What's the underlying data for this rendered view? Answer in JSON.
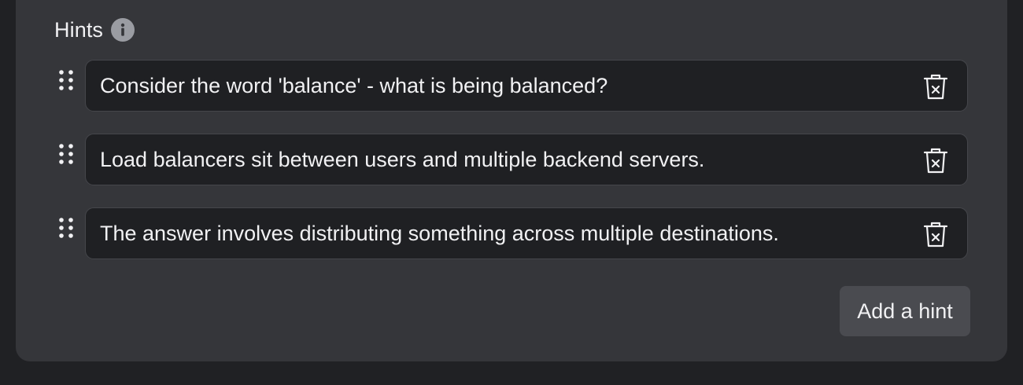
{
  "section": {
    "title": "Hints",
    "info_icon": "info-icon"
  },
  "hints": [
    {
      "text": "Consider the word 'balance' - what is being balanced?",
      "drag_icon": "drag-handle-icon",
      "delete_icon": "trash-icon"
    },
    {
      "text": "Load balancers sit between users and multiple backend servers.",
      "drag_icon": "drag-handle-icon",
      "delete_icon": "trash-icon"
    },
    {
      "text": "The answer involves distributing something across multiple destinations.",
      "drag_icon": "drag-handle-icon",
      "delete_icon": "trash-icon"
    }
  ],
  "actions": {
    "add_hint_label": "Add a hint"
  },
  "colors": {
    "page_background": "#202124",
    "panel_background": "#35363a",
    "input_background": "#1f2023",
    "text": "#f1f1f3",
    "button_background": "#4a4b50"
  }
}
